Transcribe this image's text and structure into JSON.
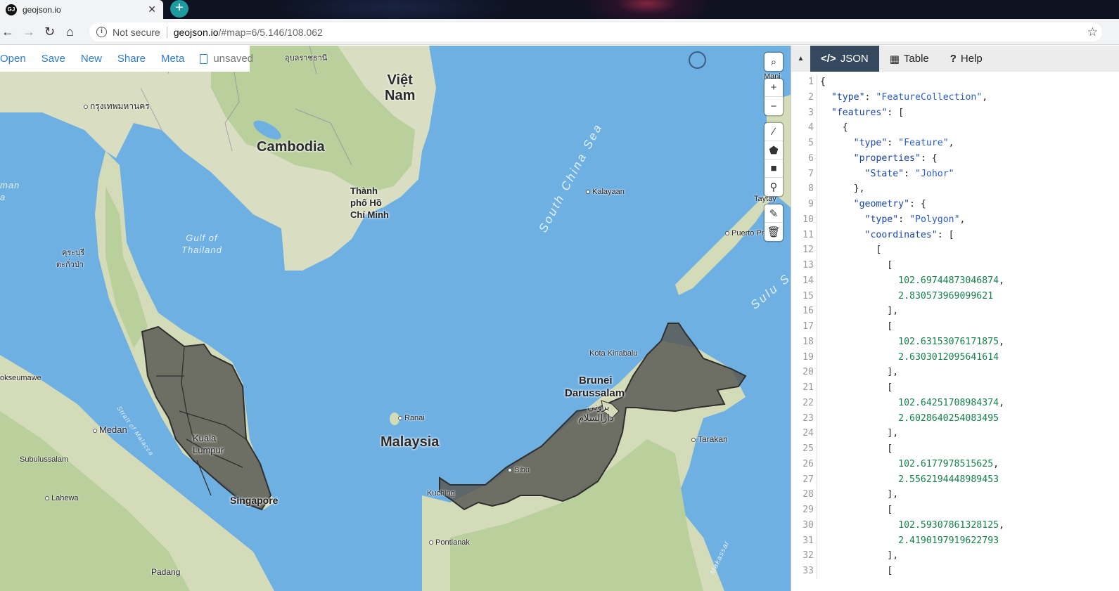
{
  "browser": {
    "tab_title": "geojson.io",
    "favicon_text": "GJ",
    "address_not_secure": "Not secure",
    "address_host": "geojson.io",
    "address_path": "/#map=6/5.146/108.062"
  },
  "toolbar": {
    "items": [
      "Open",
      "Save",
      "New",
      "Share",
      "Meta"
    ],
    "status": "unsaved"
  },
  "map": {
    "labels": {
      "viet_nam_1": "Việt",
      "viet_nam_2": "Nam",
      "cambodia": "Cambodia",
      "malaysia": "Malaysia",
      "brunei_1": "Brunei",
      "brunei_2": "Darussalam",
      "brunei_ar_1": "بروني",
      "brunei_ar_2": "دارالسلام",
      "hcmc_1": "Thành",
      "hcmc_2": "phố Hồ",
      "hcmc_3": "Chí Minh",
      "kuala_lumpur_1": "Kuala",
      "kuala_lumpur_2": "Lumpur",
      "singapore": "Singapore",
      "bangkok": "กรุงเทพมหานคร",
      "ubon": "อุบลราชธานี",
      "ranong_1": "คุระบุรี",
      "ranong_2": "ตะกั่วป่า",
      "kalayaan": "Kalayaan",
      "taytay": "Taytay",
      "puerto_princesa": "Puerto Pr",
      "manila": "Mani",
      "kota_kinabalu": "Kota Kinabalu",
      "ranai": "Ranai",
      "tarakan": "Tarakan",
      "sibu": "Sibu",
      "kuching": "Kuching",
      "pontianak": "Pontianak",
      "medan": "Medan",
      "lhokseumawe": "okseumawe",
      "subulussalam": "Subulussalam",
      "lahewa": "Lahewa",
      "padang": "Padang",
      "andaman_1": "man",
      "andaman_2": "a",
      "gulf_1": "Gulf of",
      "gulf_2": "Thailand",
      "south_china_sea": "South China Sea",
      "sulu_sea": "Sulu S",
      "strait_malacca": "Strait of Malacca",
      "makassar": "Makassar"
    },
    "colors": {
      "water": "#6fb0e2",
      "land": "#d9dec2",
      "forest": "#b8cf9a",
      "polygon_fill": "#5b5b55",
      "polygon_stroke": "#2f2f2f"
    }
  },
  "controls": {
    "search": "search-icon",
    "zoom_in": "+",
    "zoom_out": "−",
    "draw_tools": [
      "line-icon",
      "polygon-icon",
      "rectangle-icon",
      "marker-icon"
    ],
    "edit_tools": [
      "edit-icon",
      "trash-icon"
    ]
  },
  "panel": {
    "tabs": [
      {
        "icon": "</>",
        "label": "JSON"
      },
      {
        "icon": "▦",
        "label": "Table"
      },
      {
        "icon": "?",
        "label": "Help"
      }
    ],
    "code_lines": [
      {
        "n": "1",
        "t": "{"
      },
      {
        "n": "2",
        "t": "  \"type\": \"FeatureCollection\","
      },
      {
        "n": "3",
        "t": "  \"features\": ["
      },
      {
        "n": "4",
        "t": "    {"
      },
      {
        "n": "5",
        "t": "      \"type\": \"Feature\","
      },
      {
        "n": "6",
        "t": "      \"properties\": {"
      },
      {
        "n": "7",
        "t": "        \"State\": \"Johor\""
      },
      {
        "n": "8",
        "t": "      },"
      },
      {
        "n": "9",
        "t": "      \"geometry\": {"
      },
      {
        "n": "10",
        "t": "        \"type\": \"Polygon\","
      },
      {
        "n": "11",
        "t": "        \"coordinates\": ["
      },
      {
        "n": "12",
        "t": "          ["
      },
      {
        "n": "13",
        "t": "            ["
      },
      {
        "n": "14",
        "t": "              102.69744873046874,"
      },
      {
        "n": "15",
        "t": "              2.830573969099621"
      },
      {
        "n": "16",
        "t": "            ],"
      },
      {
        "n": "17",
        "t": "            ["
      },
      {
        "n": "18",
        "t": "              102.63153076171875,"
      },
      {
        "n": "19",
        "t": "              2.6303012095641614"
      },
      {
        "n": "20",
        "t": "            ],"
      },
      {
        "n": "21",
        "t": "            ["
      },
      {
        "n": "22",
        "t": "              102.64251708984374,"
      },
      {
        "n": "23",
        "t": "              2.6028640254083495"
      },
      {
        "n": "24",
        "t": "            ],"
      },
      {
        "n": "25",
        "t": "            ["
      },
      {
        "n": "26",
        "t": "              102.6177978515625,"
      },
      {
        "n": "27",
        "t": "              2.5562194448989453"
      },
      {
        "n": "28",
        "t": "            ],"
      },
      {
        "n": "29",
        "t": "            ["
      },
      {
        "n": "30",
        "t": "              102.59307861328125,"
      },
      {
        "n": "31",
        "t": "              2.4190197919622793"
      },
      {
        "n": "32",
        "t": "            ],"
      },
      {
        "n": "33",
        "t": "            ["
      }
    ]
  }
}
